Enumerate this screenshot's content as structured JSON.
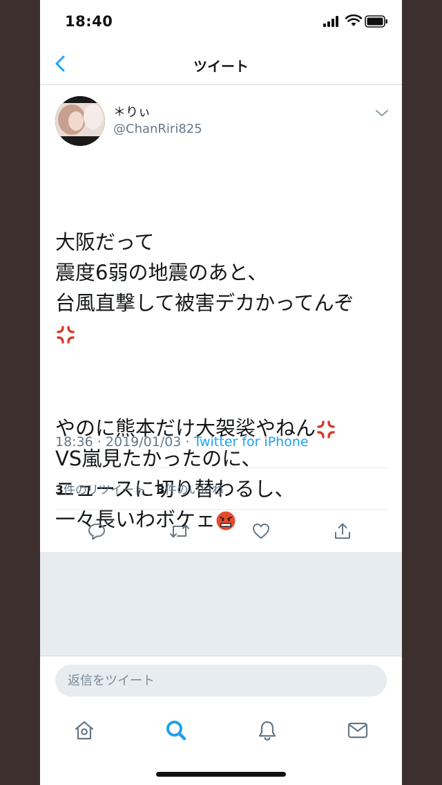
{
  "status_bar": {
    "time": "18:40"
  },
  "nav": {
    "title": "ツイート"
  },
  "tweet": {
    "user_name": "＊りぃ",
    "handle": "@ChanRiri825",
    "text_p1_l1": "大阪だって",
    "text_p1_l2": "震度6弱の地震のあと、",
    "text_p1_l3": "台風直撃して被害デカかってんぞ",
    "text_p2_l1": "やのに熊本だけ大袈裟やねん",
    "text_p2_l2": "VS嵐見たかったのに、",
    "text_p2_l3": "ニュースに切り替わるし、",
    "text_p2_l4": "一々長いわボケェ",
    "time": "18:36",
    "date": "2019/01/03",
    "source": "Twitter for iPhone",
    "retweet_count": "3",
    "retweet_label": "件のリツイート",
    "like_count": "3",
    "like_label": "件のいいね"
  },
  "reply": {
    "placeholder": "返信をツイート"
  },
  "icons": {
    "accent": "#1da1f2",
    "actions": [
      "reply-icon",
      "retweet-icon",
      "like-icon",
      "share-icon"
    ],
    "tabs": [
      "home-icon",
      "search-icon",
      "notifications-icon",
      "messages-icon"
    ]
  }
}
